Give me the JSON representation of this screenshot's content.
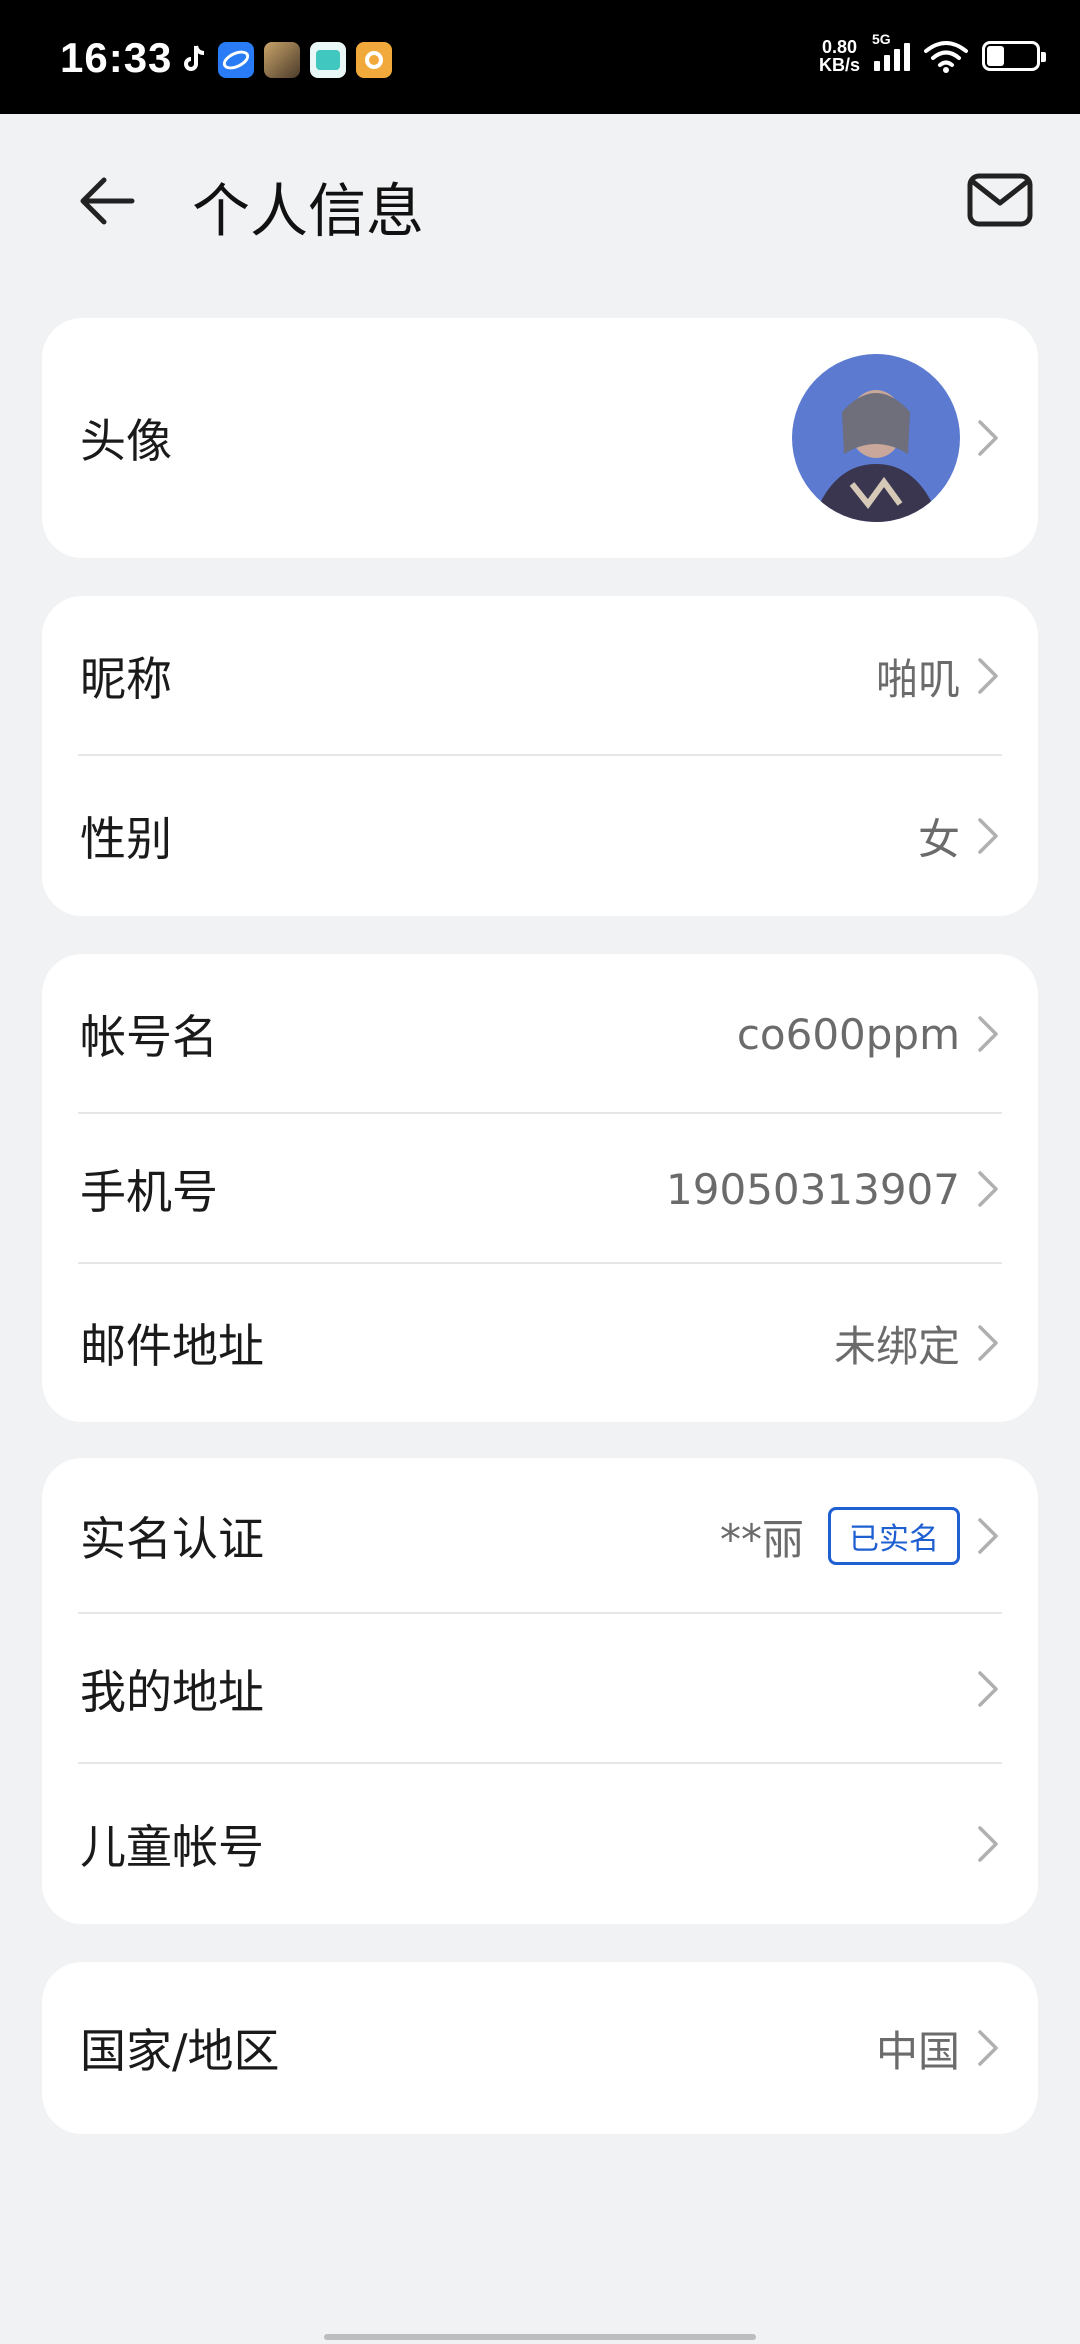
{
  "status_bar": {
    "time": "16:33",
    "net_speed_value": "0.80",
    "net_speed_unit": "KB/s",
    "network_type": "5G",
    "battery_level": 0.35,
    "apps": [
      {
        "icon": "tiktok-icon",
        "color": "#000000"
      },
      {
        "icon": "browser-icon",
        "color": "#2a7bf6"
      },
      {
        "icon": "game-app-icon",
        "color": "#7a5b3a"
      },
      {
        "icon": "teal-app-icon",
        "color": "#3fc7c0"
      },
      {
        "icon": "music-app-icon",
        "color": "#f2a93b"
      }
    ]
  },
  "header": {
    "title": "个人信息",
    "back_icon": "back-arrow-icon",
    "mail_icon": "mail-icon"
  },
  "sections": {
    "avatar": {
      "label": "头像"
    },
    "nickname": {
      "label": "昵称",
      "value": "啪叽"
    },
    "gender": {
      "label": "性别",
      "value": "女"
    },
    "account_name": {
      "label": "帐号名",
      "value": "co600ppm"
    },
    "phone": {
      "label": "手机号",
      "value": "19050313907"
    },
    "email": {
      "label": "邮件地址",
      "value": "未绑定"
    },
    "real_name": {
      "label": "实名认证",
      "value": "**丽",
      "badge": "已实名"
    },
    "my_address": {
      "label": "我的地址"
    },
    "child_account": {
      "label": "儿童帐号"
    },
    "region": {
      "label": "国家/地区",
      "value": "中国"
    }
  },
  "colors": {
    "accent": "#1e5fd1",
    "background": "#f1f2f4",
    "card": "#ffffff"
  }
}
